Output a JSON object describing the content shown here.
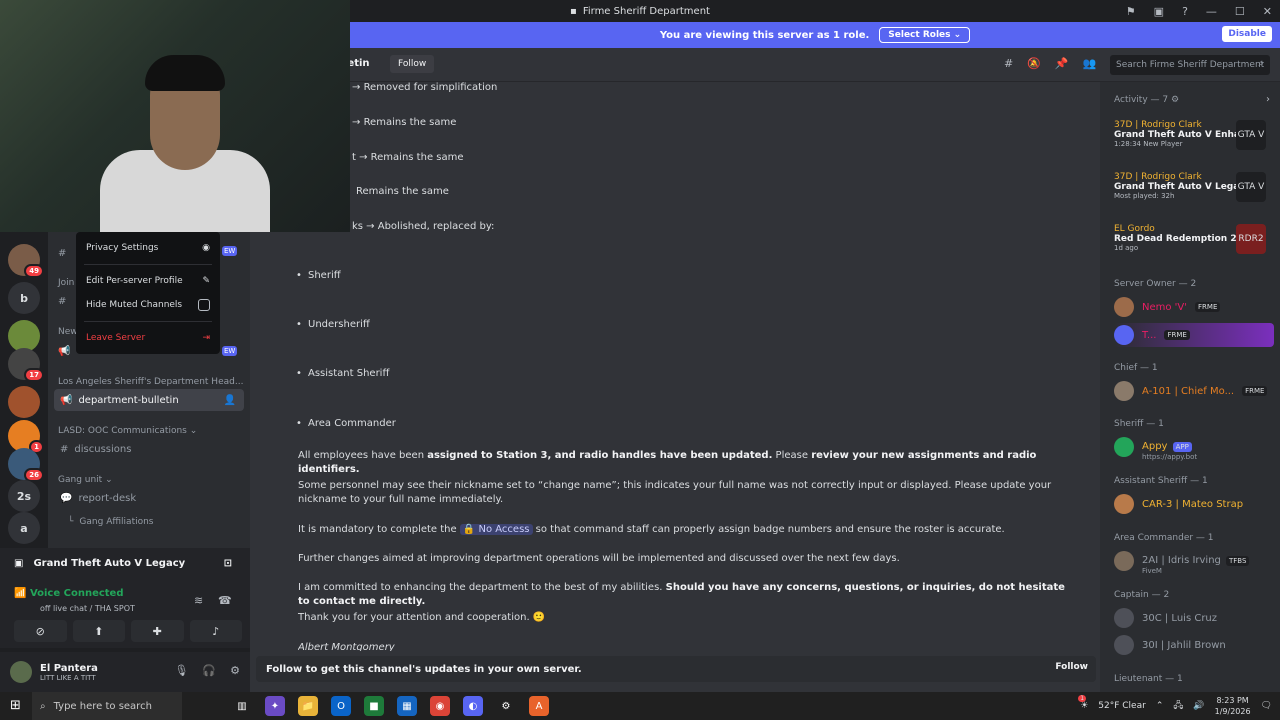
{
  "titlebar": {
    "title": "Firme Sheriff Department"
  },
  "banner": {
    "text": "You are viewing this server as 1 role.",
    "select_label": "Select Roles",
    "disable_label": "Disable"
  },
  "header": {
    "channel": "department-bulletin",
    "follow_label": "Follow",
    "search_placeholder": "Search Firme Sheriff Department"
  },
  "guilds": [
    {
      "label": "",
      "badge": "49"
    },
    {
      "label": "b",
      "badge": ""
    },
    {
      "label": "",
      "badge": "17"
    },
    {
      "label": "",
      "badge": "1"
    },
    {
      "label": "",
      "badge": "26"
    },
    {
      "label": "2s",
      "badge": ""
    },
    {
      "label": "a",
      "badge": ""
    }
  ],
  "context_menu": {
    "privacy": "Privacy Settings",
    "edit_profile": "Edit Per-server Profile",
    "hide_muted": "Hide Muted Channels",
    "leave": "Leave Server"
  },
  "channels": {
    "partial_join": "Join",
    "partial_new": "New",
    "new_badge": "EW",
    "cat1": "Los Angeles Sheriff's Department Head...",
    "ch1": "department-bulletin",
    "cat2": "LASD: OOC Communications",
    "ch2": "discussions",
    "cat3": "Gang unit",
    "ch3": "report-desk",
    "ch3sub": "Gang Affiliations"
  },
  "voice": {
    "game": "Grand Theft Auto V Legacy",
    "status": "Voice Connected",
    "location": "off live chat / THA SPOT"
  },
  "user": {
    "name": "El Pantera",
    "status": "LITT LIKE A TITT"
  },
  "messages": {
    "a1": "Removed for simplification",
    "a2": "Remains the same",
    "a3": "t → Remains the same",
    "a4": "Remains the same",
    "a5": "ks → Abolished, replaced by:",
    "b1": "Sheriff",
    "b2": "Undersheriff",
    "b3": "Assistant Sheriff",
    "b4": "Area Commander",
    "p1_a": "All employees have been ",
    "p1_b": "assigned to Station 3, and radio handles have been updated.",
    "p1_c": " Please ",
    "p1_d": "review your new assignments and radio identifiers.",
    "p2": "Some personnel may see their nickname set to “change name”; this indicates your full name was not correctly input or displayed. Please update your nickname to your full name immediately.",
    "p3_a": "It is mandatory to complete the ",
    "p3_b": "No Access",
    "p3_c": " so that command staff can properly assign badge numbers and ensure the roster is accurate.",
    "p4": "Further changes aimed at improving department operations will be implemented and discussed over the next few days.",
    "p5_a": "I am committed to enhancing the department to the best of my abilities. ",
    "p5_b": "Should you have any concerns, questions, or inquiries, do not hesitate to contact me directly.",
    "p6": "Thank you for your attention and cooperation. 🙂",
    "sig": "Albert Montgomery"
  },
  "followbar": {
    "text": "Follow to get this channel's updates in your own server.",
    "button": "Follow"
  },
  "members": {
    "activity_header": "Activity — 7",
    "activities": [
      {
        "name": "37D | Rodrigo Clark",
        "title": "Grand Theft Auto V Enhan...",
        "sub": "1:28:34  New Player",
        "icon": "GTA V"
      },
      {
        "name": "37D | Rodrigo Clark",
        "title": "Grand Theft Auto V Legacy",
        "sub": "Most played: 32h",
        "icon": "GTA V"
      },
      {
        "name": "EL Gordo",
        "title": "Red Dead Redemption 2",
        "sub": "1d ago",
        "icon": "RDR2"
      }
    ],
    "owner_header": "Server Owner — 2",
    "owner1": "Nemo 'V'",
    "owner2": "T...",
    "frme": "FRME",
    "chief_header": "Chief — 1",
    "chief1": "A-101 | Chief Mo...",
    "sheriff_header": "Sheriff — 1",
    "sheriff1": "Appy",
    "appy_tag": "APP",
    "appy_sub": "https://appy.bot",
    "asst_header": "Assistant Sheriff — 1",
    "asst1": "CAR-3 | Mateo Strap",
    "area_header": "Area Commander — 1",
    "area1": "2AI | Idris Irving",
    "area1_tag": "TFBS",
    "area1_sub": "FiveM",
    "captain_header": "Captain — 2",
    "captain1": "30C | Luis Cruz",
    "captain2": "30I | Jahlil Brown",
    "lt_header": "Lieutenant — 1"
  },
  "taskbar": {
    "search_placeholder": "Type here to search",
    "weather": "52°F  Clear",
    "time": "8:23 PM",
    "date": "1/9/2026",
    "weather_badge": "1"
  }
}
